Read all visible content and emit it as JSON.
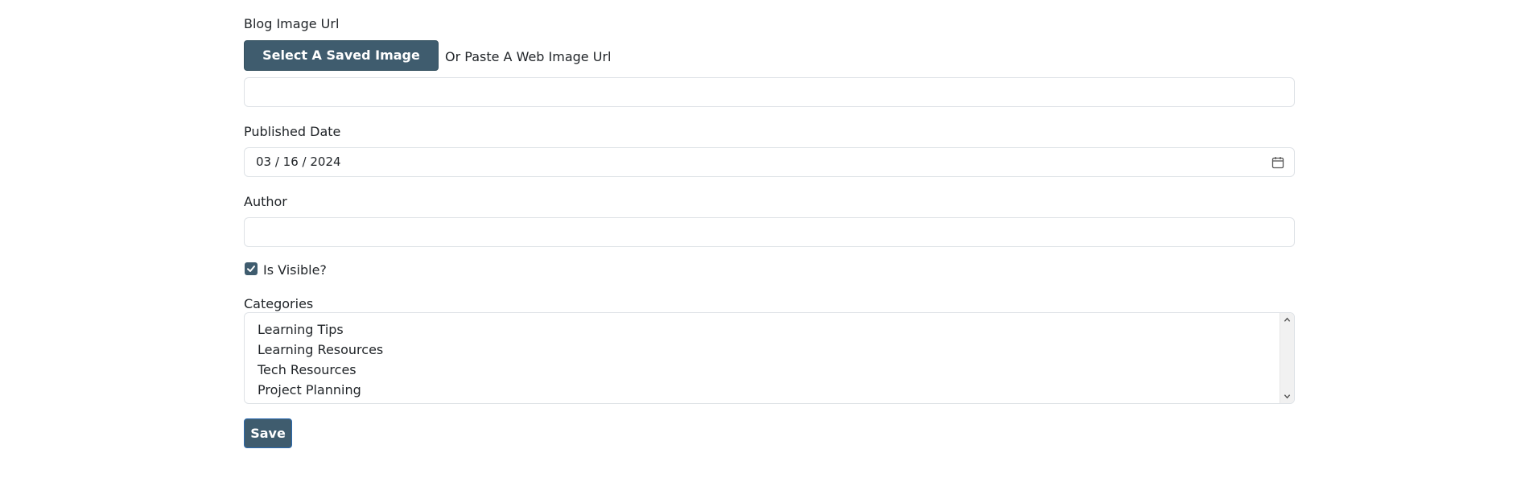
{
  "blog_image": {
    "label": "Blog Image Url",
    "select_button_label": "Select A Saved Image",
    "or_text": "Or Paste A Web Image Url",
    "url_value": ""
  },
  "published_date": {
    "label": "Published Date",
    "value": "03 / 16 / 2024",
    "icon": "calendar-icon"
  },
  "author": {
    "label": "Author",
    "value": ""
  },
  "is_visible": {
    "label": "Is Visible?",
    "checked": true
  },
  "categories": {
    "label": "Categories",
    "options": [
      "Learning Tips",
      "Learning Resources",
      "Tech Resources",
      "Project Planning"
    ]
  },
  "save_label": "Save",
  "colors": {
    "primary": "#3f5c6e",
    "border": "#dee2e6",
    "text": "#212529"
  }
}
